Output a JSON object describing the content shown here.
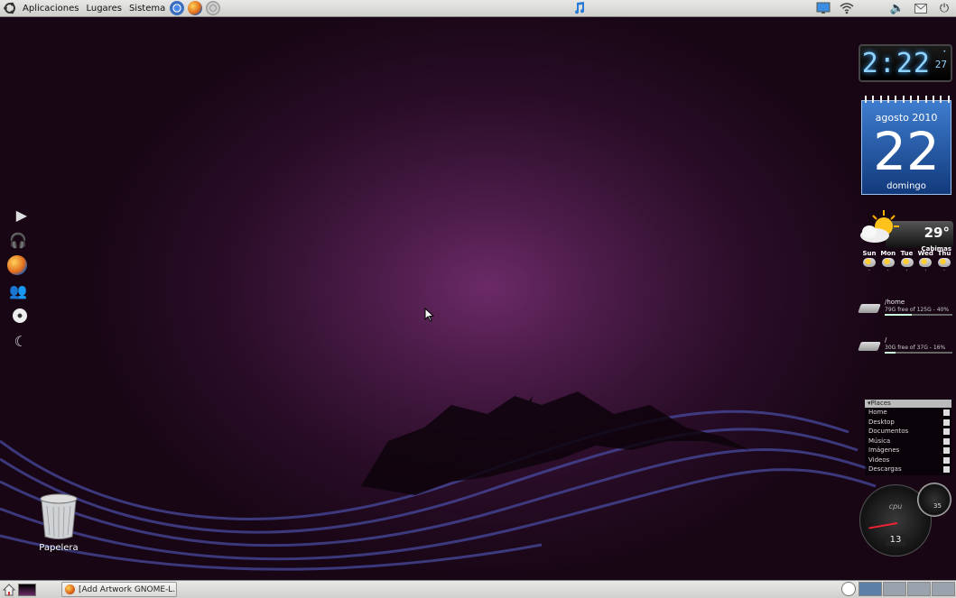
{
  "top_panel": {
    "menu": [
      "Aplicaciones",
      "Lugares",
      "Sistema"
    ],
    "launcher_icons": [
      "chromium-icon",
      "firefox-icon",
      "help-icon"
    ],
    "center_icon": "music-note-icon",
    "tray_icons": [
      "display-icon",
      "wifi-icon",
      "volume-icon",
      "mail-icon",
      "power-icon"
    ]
  },
  "dock": {
    "icons": [
      "play-icon",
      "headphones-icon",
      "firefox-icon",
      "users-icon",
      "disc-icon",
      "moon-icon"
    ]
  },
  "trash": {
    "label": "Papelera"
  },
  "clock_widget": {
    "time": "2:22",
    "seconds": "27"
  },
  "calendar_widget": {
    "month": "agosto 2010",
    "day": "22",
    "weekday": "domingo"
  },
  "weather_widget": {
    "temperature": "29°",
    "city": "Cabimas",
    "days": [
      "Sun",
      "Mon",
      "Tue",
      "Wed",
      "Thu"
    ]
  },
  "disks": [
    {
      "mount": "/home",
      "info": "79G free of 125G - 40%",
      "fill": 0.4
    },
    {
      "mount": "/",
      "info": "30G free of 37G - 16%",
      "fill": 0.16
    }
  ],
  "places_widget": {
    "title": "Places",
    "items": [
      "Home",
      "Desktop",
      "Documentos",
      "Música",
      "Imágenes",
      "Videos",
      "Descargas"
    ]
  },
  "cpu_gauge": {
    "label": "cpu",
    "value": "13",
    "small_value": "35"
  },
  "bottom_panel": {
    "task_label": "[Add Artwork GNOME-L...",
    "workspaces": 4
  },
  "colors": {
    "desktop_center": "#6b2a66",
    "desktop_edge": "#180615",
    "panel": "#dcdcda",
    "clock_digits": "#8fd3ff"
  }
}
